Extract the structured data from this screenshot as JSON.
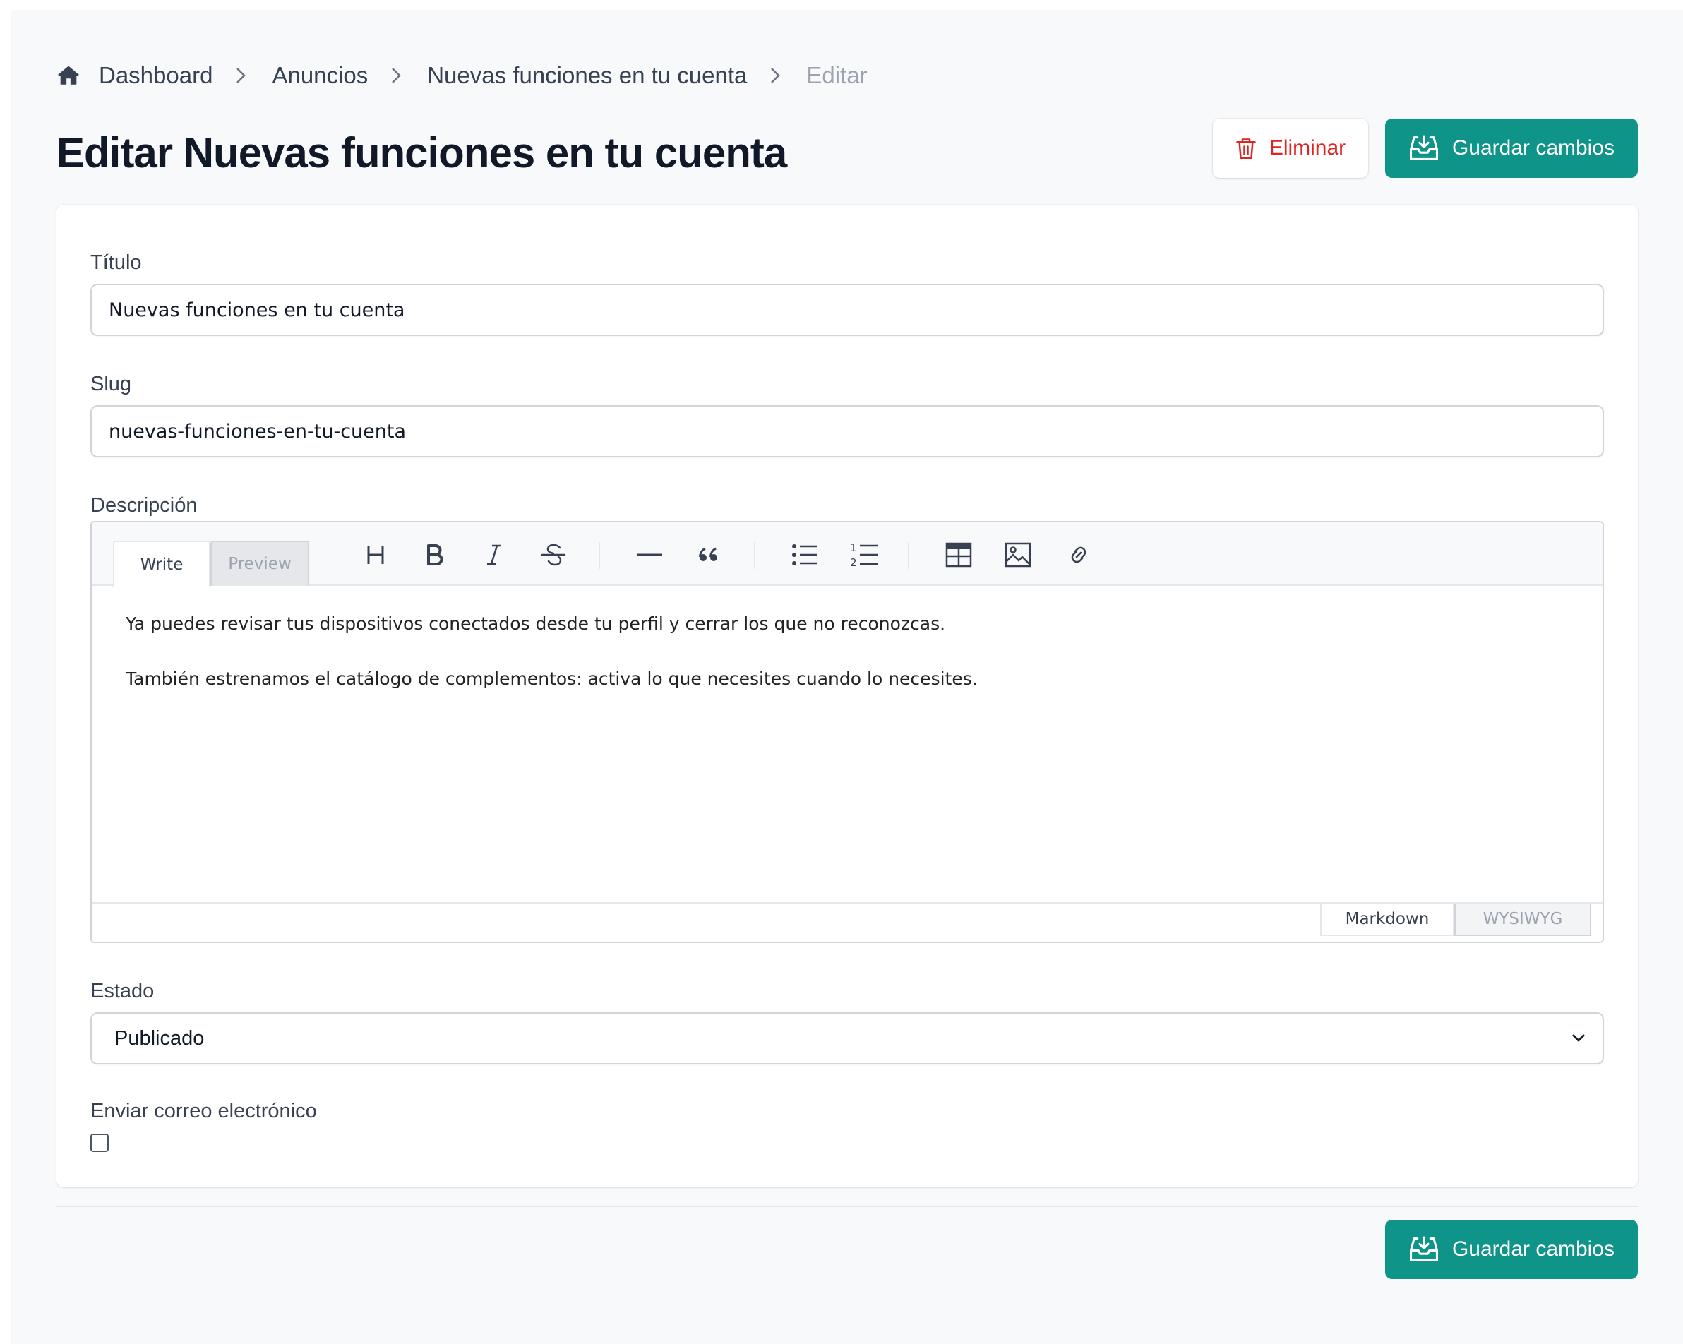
{
  "breadcrumb": {
    "items": [
      "Dashboard",
      "Anuncios",
      "Nuevas funciones en tu cuenta"
    ],
    "current": "Editar"
  },
  "header": {
    "title": "Editar Nuevas funciones en tu cuenta",
    "delete_label": "Eliminar",
    "save_label": "Guardar cambios"
  },
  "form": {
    "title_label": "Título",
    "title_value": "Nuevas funciones en tu cuenta",
    "slug_label": "Slug",
    "slug_value": "nuevas-funciones-en-tu-cuenta",
    "description_label": "Descripción",
    "editor": {
      "tabs": [
        "Write",
        "Preview"
      ],
      "active_tab": "Write",
      "toolbar_icons": [
        "heading-icon",
        "bold-icon",
        "italic-icon",
        "strikethrough-icon",
        "horizontal-rule-icon",
        "quote-icon",
        "bullet-list-icon",
        "numbered-list-icon",
        "table-icon",
        "image-icon",
        "link-icon"
      ],
      "paragraphs": [
        "Ya puedes revisar tus dispositivos conectados desde tu perfil y cerrar los que no reconozcas.",
        "También estrenamos el catálogo de complementos: activa lo que necesites cuando lo necesites."
      ],
      "modes": [
        "Markdown",
        "WYSIWYG"
      ],
      "active_mode": "Markdown"
    },
    "status_label": "Estado",
    "status_value": "Publicado",
    "email_label": "Enviar correo electrónico",
    "email_checked": false
  },
  "footer": {
    "save_label": "Guardar cambios"
  },
  "colors": {
    "primary": "#0e9488",
    "danger": "#dc2626",
    "background": "#f8f9fb"
  }
}
